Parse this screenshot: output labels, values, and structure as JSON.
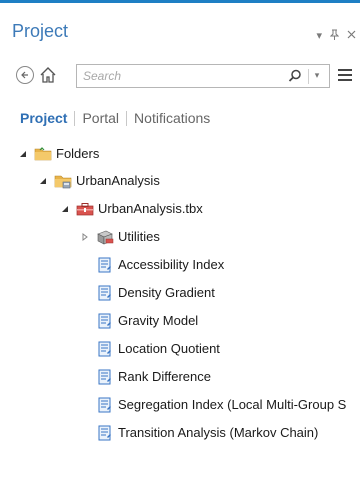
{
  "header": {
    "title": "Project",
    "pin_glyph": "⮶",
    "autohide_glyph": "⥑",
    "close_glyph": "✕"
  },
  "toolbar": {
    "search_placeholder": "Search"
  },
  "tabs": [
    {
      "label": "Project",
      "active": true
    },
    {
      "label": "Portal",
      "active": false
    },
    {
      "label": "Notifications",
      "active": false
    }
  ],
  "tree": {
    "folders": "Folders",
    "urban_folder": "UrbanAnalysis",
    "toolbox": "UrbanAnalysis.tbx",
    "utilities": "Utilities",
    "tools": [
      "Accessibility Index",
      "Density Gradient",
      "Gravity Model",
      "Location Quotient",
      "Rank Difference",
      "Segregation Index (Local Multi-Group S",
      "Transition Analysis (Markov Chain)"
    ]
  },
  "colors": {
    "accent": "#1e7fc4",
    "title": "#3d7ab8",
    "folder": "#e8b34a",
    "toolbox": "#d9534f",
    "tool": "#3a76c4"
  }
}
